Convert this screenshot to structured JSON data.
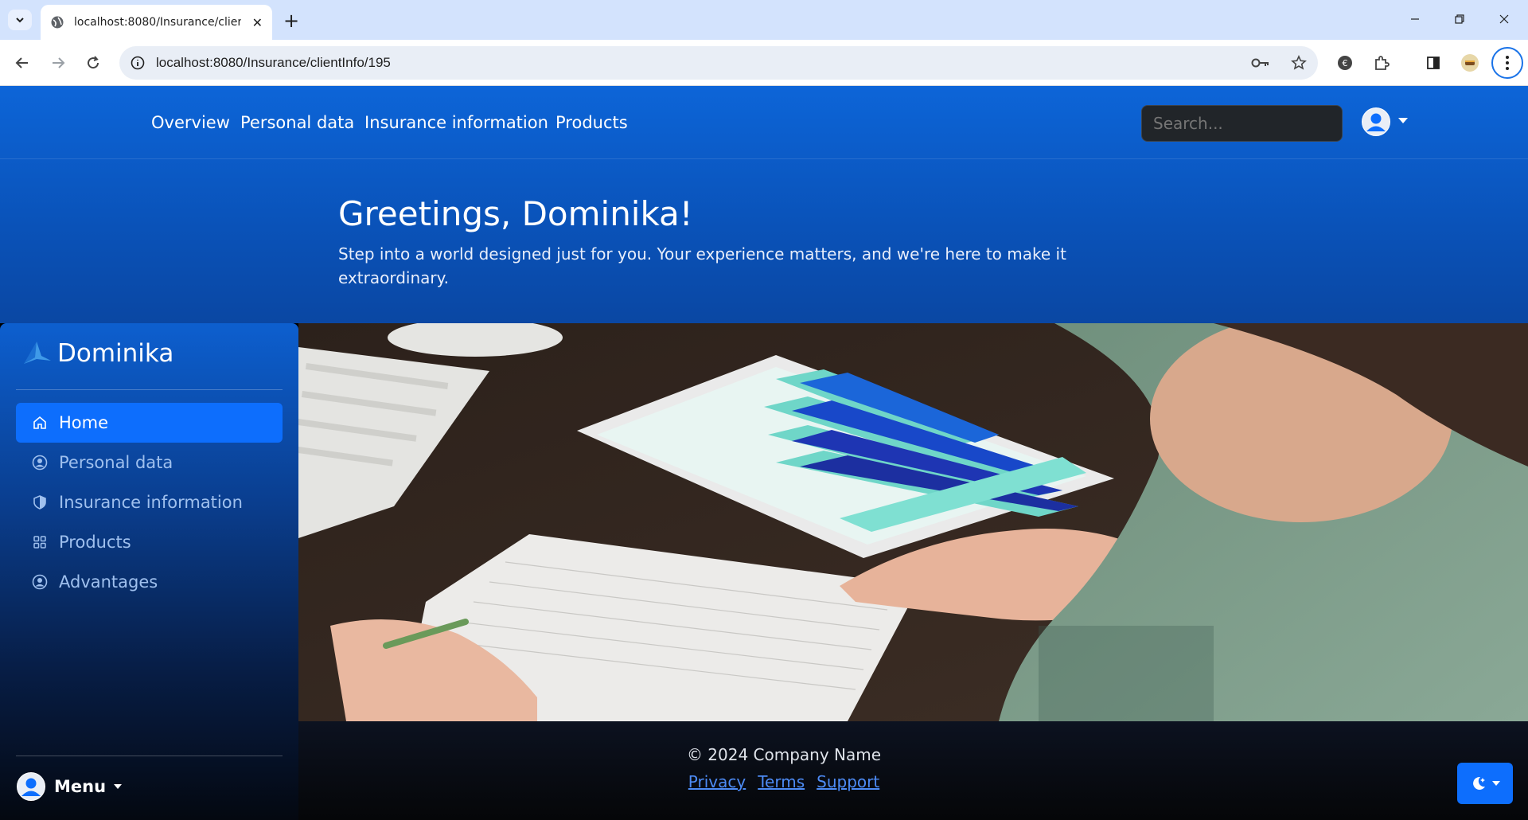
{
  "browser": {
    "tab_title": "localhost:8080/Insurance/clientInfo/195",
    "url": "localhost:8080/Insurance/clientInfo/195"
  },
  "nav": {
    "links": [
      "Overview",
      "Personal data",
      "Insurance information",
      "Products"
    ],
    "search_placeholder": "Search..."
  },
  "hero": {
    "title": "Greetings, Dominika!",
    "text": "Step into a world designed just for you. Your experience matters, and we're here to make it extraordinary."
  },
  "sidebar": {
    "brand": "Dominika",
    "items": [
      {
        "label": "Home",
        "icon": "home-icon",
        "active": true
      },
      {
        "label": "Personal data",
        "icon": "user-circle-icon",
        "active": false
      },
      {
        "label": "Insurance information",
        "icon": "shield-icon",
        "active": false
      },
      {
        "label": "Products",
        "icon": "grid-icon",
        "active": false
      },
      {
        "label": "Advantages",
        "icon": "user-circle-icon",
        "active": false
      }
    ],
    "menu_label": "Menu"
  },
  "footer": {
    "copyright": "© 2024 Company Name",
    "links": [
      "Privacy",
      "Terms",
      "Support"
    ]
  },
  "colors": {
    "accent": "#0d6efd",
    "nav_bg": "#0d65d8"
  }
}
